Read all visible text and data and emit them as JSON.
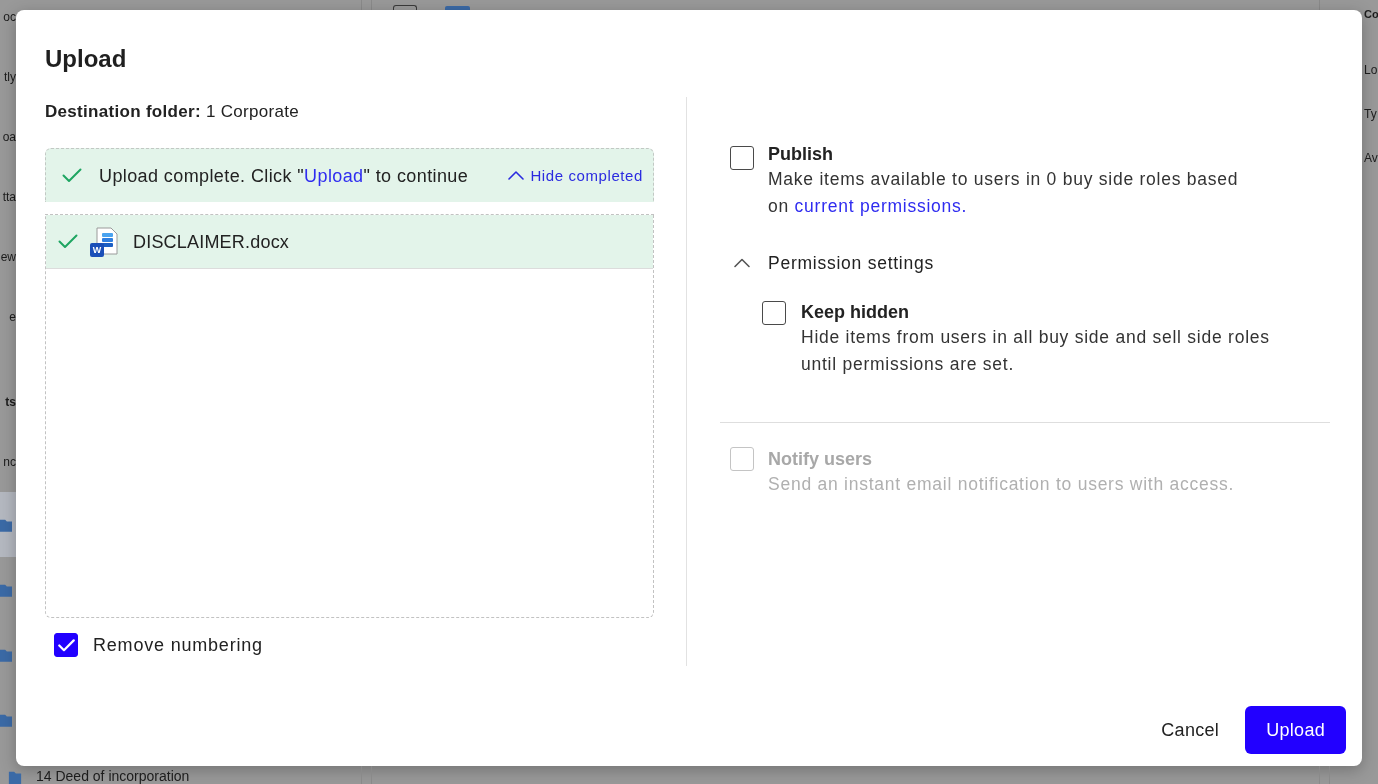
{
  "background": {
    "sidebar_fragments": [
      {
        "text": "oc",
        "bold": false
      },
      {
        "text": "tly",
        "bold": false
      },
      {
        "text": "oa",
        "bold": false
      },
      {
        "text": "tta",
        "bold": false
      },
      {
        "text": "ew",
        "bold": false
      },
      {
        "text": "e",
        "bold": false
      },
      {
        "text": "ts",
        "bold": true
      },
      {
        "text": "nc",
        "bold": false
      }
    ],
    "folder_rows": [
      {
        "selected": true
      },
      {
        "selected": false
      },
      {
        "selected": false
      },
      {
        "selected": false
      }
    ],
    "bottom_row": "14 Deed of incorporation",
    "details_fragments": [
      {
        "text": "Co",
        "bold": true
      },
      {
        "text": "Lo",
        "bold": false
      },
      {
        "text": "Ty",
        "bold": false
      },
      {
        "text": "Av",
        "bold": false
      }
    ]
  },
  "dialog": {
    "title": "Upload",
    "destination": {
      "label": "Destination folder:",
      "value": "1 Corporate"
    },
    "status_banner": {
      "message_before": "Upload complete. Click \"",
      "link": "Upload",
      "message_after": "\" to continue",
      "action": "Hide completed"
    },
    "files": [
      {
        "name": "DISCLAIMER.docx",
        "badge": "W",
        "uploaded": true
      }
    ],
    "remove_numbering": {
      "label": "Remove numbering",
      "checked": true
    },
    "publish": {
      "label": "Publish",
      "description": "Make items available to users in 0 buy side roles based on",
      "link": "current permissions.",
      "checked": false
    },
    "permission_settings": {
      "label": "Permission settings",
      "expanded": true,
      "options": [
        {
          "label": "Keep hidden",
          "description": "Hide items from users in all buy side and sell side roles until permissions are set.",
          "checked": false
        }
      ]
    },
    "notify": {
      "label": "Notify users",
      "description": "Send an instant email notification to users with access.",
      "checked": false,
      "disabled": true
    },
    "buttons": [
      {
        "label": "Cancel",
        "kind": "secondary"
      },
      {
        "label": "Upload",
        "kind": "primary"
      }
    ]
  }
}
